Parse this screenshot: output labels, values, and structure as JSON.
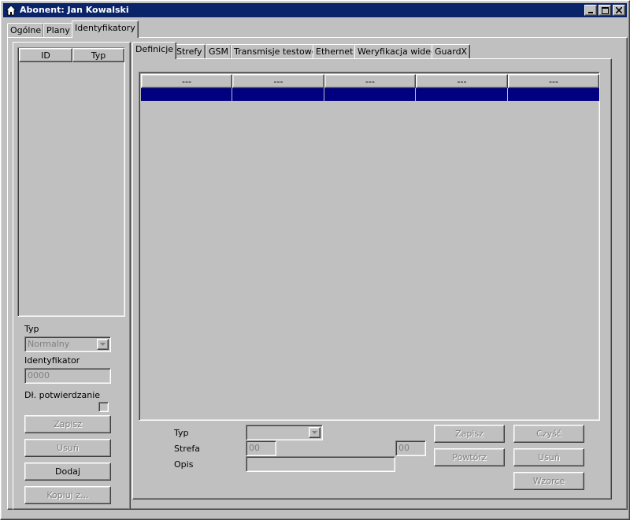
{
  "window": {
    "title": "Abonent: Jan Kowalski",
    "icon": "home-icon",
    "controls": [
      "minimize-icon",
      "maximize-icon",
      "close-icon"
    ]
  },
  "main_tabs": [
    "Ogólne",
    "Plany",
    "Identyfikatory"
  ],
  "main_active_tab": "Identyfikatory",
  "left_panel": {
    "list_headers": [
      "ID",
      "Typ"
    ],
    "type_label": "Typ",
    "type_value": "Normalny",
    "identifier_label": "Identyfikator",
    "identifier_placeholder": "0000",
    "long_confirm_label": "Dł. potwierdzanie",
    "buttons": {
      "save": "Zapisz",
      "delete": "Usuń",
      "add": "Dodaj",
      "copy_from": "Kopiuj z..."
    }
  },
  "sub_tabs": [
    "Definicje",
    "Strefy",
    "GSM",
    "Transmisje testowe",
    "Ethernet",
    "Weryfikacja wideo",
    "GuardX"
  ],
  "sub_active_tab": "Definicje",
  "grid": {
    "headers": [
      "---",
      "---",
      "---",
      "---",
      "---"
    ],
    "selected_row_color": "#000080"
  },
  "form": {
    "type_label": "Typ",
    "zone_label": "Strefa",
    "zone_from": "00",
    "zone_to": "00",
    "desc_label": "Opis",
    "buttons": {
      "save": "Zapisz",
      "clear": "Czyść",
      "repeat": "Powtórz",
      "delete": "Usuń",
      "templates": "Wzorce"
    }
  },
  "colors": {
    "titlebar": "#0a246a",
    "face": "#c0c0c0",
    "selection": "#000080",
    "grid_bg": "#ffffff"
  }
}
